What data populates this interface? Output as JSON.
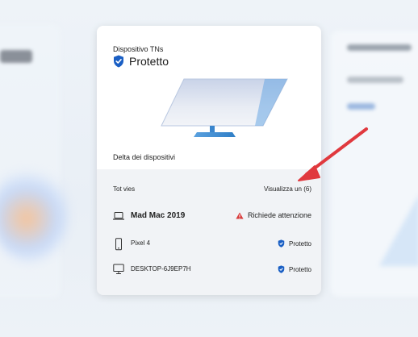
{
  "card": {
    "device_type": "Dispositivo TNs",
    "status": "Protetto",
    "fleet_label": "Delta dei dispositivi"
  },
  "devices_list": {
    "title": "Tot vies",
    "view_all": "Visualizza un (6)",
    "items": [
      {
        "name": "Mad Mac 2019",
        "icon": "laptop-icon",
        "status": "Richiede attenzione",
        "status_icon": "warning-icon"
      },
      {
        "name": "Pixel 4",
        "icon": "phone-icon",
        "status": "Protetto",
        "status_icon": "shield-check-icon"
      },
      {
        "name": "DESKTOP-6J9EP7H",
        "icon": "desktop-icon",
        "status": "Protetto",
        "status_icon": "shield-check-icon"
      }
    ]
  },
  "colors": {
    "shield_blue": "#1a5fc4",
    "warning_red": "#d83b3b",
    "arrow_red": "#e0393e"
  }
}
